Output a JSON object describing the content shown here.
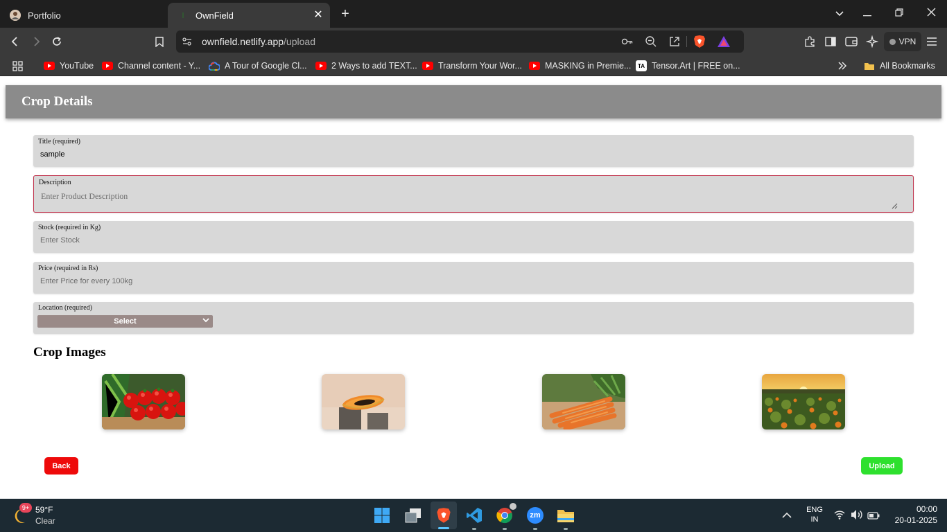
{
  "browser": {
    "tabs": [
      {
        "label": "Portfolio",
        "active": false
      },
      {
        "label": "OwnField",
        "active": true
      }
    ],
    "url": {
      "host": "ownfield.netlify.app",
      "path": "/upload"
    },
    "vpn_label": "VPN",
    "bookmarks": [
      {
        "label": "YouTube",
        "icon": "youtube-icon"
      },
      {
        "label": "Channel content - Y...",
        "icon": "youtube-icon"
      },
      {
        "label": "A Tour of Google Cl...",
        "icon": "google-cloud-icon"
      },
      {
        "label": "2 Ways to add TEXT...",
        "icon": "youtube-icon"
      },
      {
        "label": "Transform Your Wor...",
        "icon": "youtube-icon"
      },
      {
        "label": "MASKING in Premie...",
        "icon": "youtube-icon"
      },
      {
        "label": "Tensor.Art | FREE on...",
        "icon": "tensorart-icon"
      }
    ],
    "all_bookmarks_label": "All Bookmarks"
  },
  "page": {
    "header_title": "Crop Details",
    "fields": {
      "title": {
        "label": "Title (required)",
        "value": "sample"
      },
      "description": {
        "label": "Description",
        "placeholder": "Enter Product Description"
      },
      "stock": {
        "label": "Stock (required in Kg)",
        "placeholder": "Enter Stock"
      },
      "price": {
        "label": "Price (required in Rs)",
        "placeholder": "Enter Price for every 100kg"
      },
      "location": {
        "label": "Location (required)",
        "selected": "Select"
      }
    },
    "images_title": "Crop Images",
    "images": [
      "tomatoes",
      "papaya",
      "carrots",
      "pumpkin-field"
    ],
    "back_label": "Back",
    "upload_label": "Upload",
    "colors": {
      "back": "#ee0a0a",
      "upload": "#2ee02e",
      "header": "#8b8b8b",
      "field": "#d8d8d8",
      "invalid_border": "#c0304a"
    }
  },
  "taskbar": {
    "weather_temp": "59°F",
    "weather_desc": "Clear",
    "weather_badge": "9+",
    "lang": "ENG",
    "region": "IN",
    "time": "00:00",
    "date": "20-01-2025"
  }
}
